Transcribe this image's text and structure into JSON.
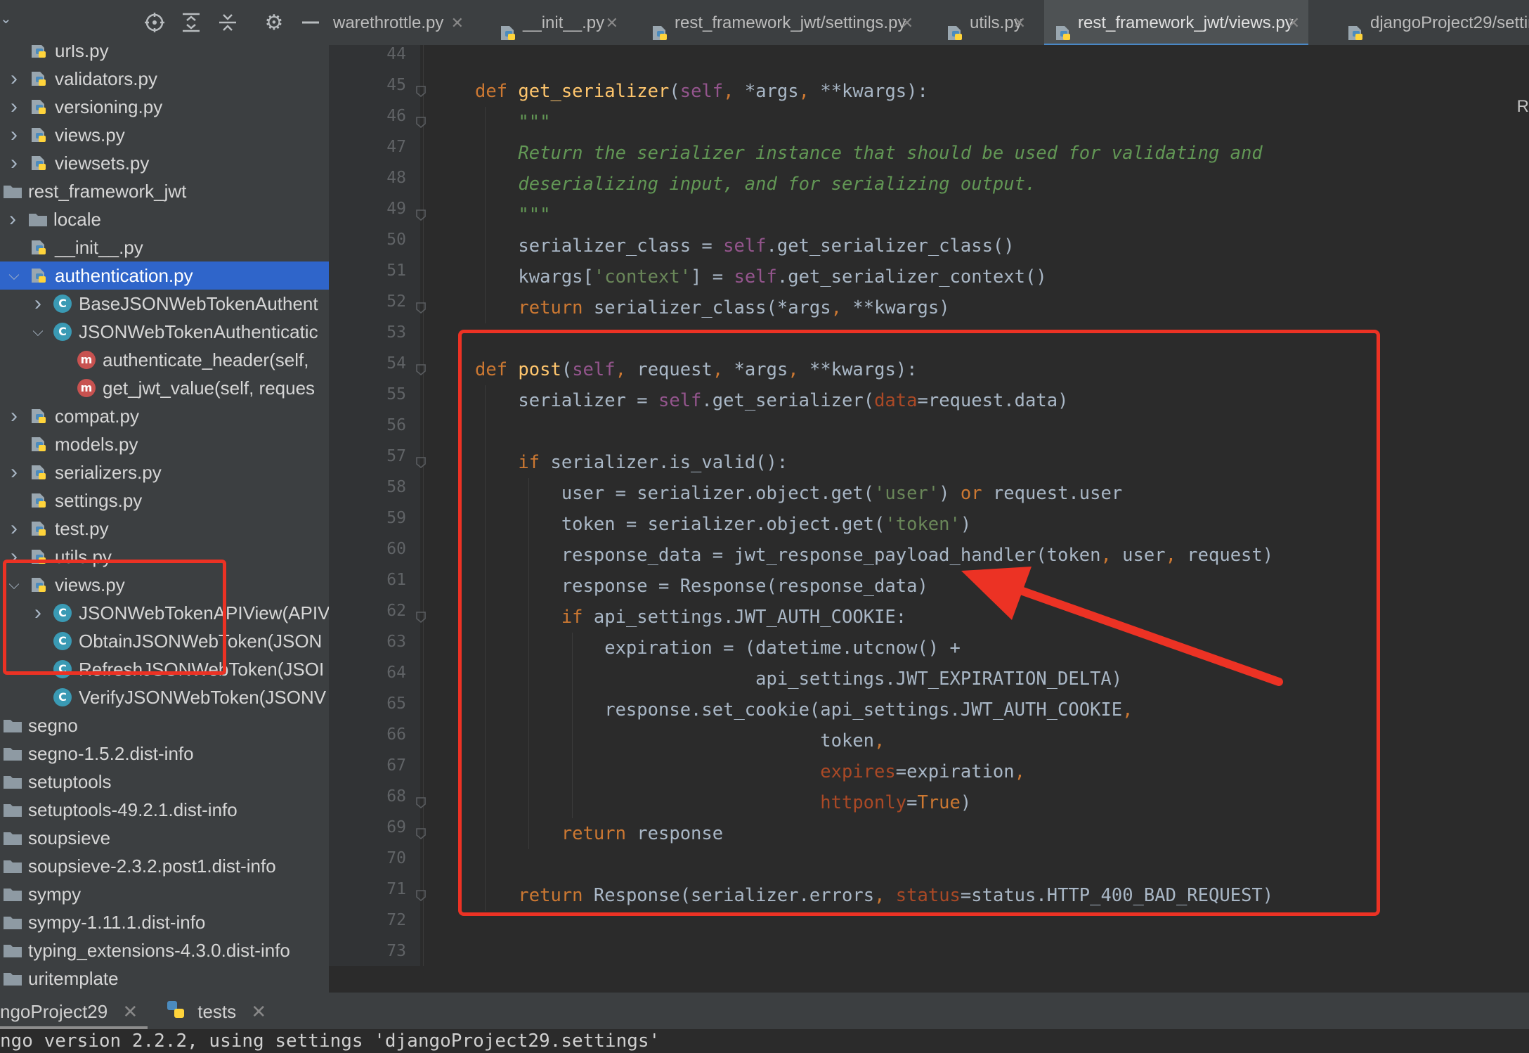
{
  "project_tree": {
    "items": [
      {
        "label": "urls.py",
        "kind": "py",
        "depth": 1,
        "arrow": ""
      },
      {
        "label": "validators.py",
        "kind": "py",
        "depth": 1,
        "arrow": ">"
      },
      {
        "label": "versioning.py",
        "kind": "py",
        "depth": 1,
        "arrow": ">"
      },
      {
        "label": "views.py",
        "kind": "py",
        "depth": 1,
        "arrow": ">"
      },
      {
        "label": "viewsets.py",
        "kind": "py",
        "depth": 1,
        "arrow": ">"
      },
      {
        "label": "rest_framework_jwt",
        "kind": "folder",
        "depth": 0,
        "arrow": ""
      },
      {
        "label": "locale",
        "kind": "folder",
        "depth": 1,
        "arrow": ">"
      },
      {
        "label": "__init__.py",
        "kind": "py",
        "depth": 1,
        "arrow": ""
      },
      {
        "label": "authentication.py",
        "kind": "py",
        "depth": 1,
        "arrow": "v",
        "selected": true
      },
      {
        "label": "BaseJSONWebTokenAuthent",
        "kind": "class",
        "depth": 2,
        "arrow": ">"
      },
      {
        "label": "JSONWebTokenAuthenticatic",
        "kind": "class",
        "depth": 2,
        "arrow": "v"
      },
      {
        "label": "authenticate_header(self,",
        "kind": "method",
        "depth": 3,
        "arrow": ""
      },
      {
        "label": "get_jwt_value(self, reques",
        "kind": "method",
        "depth": 3,
        "arrow": ""
      },
      {
        "label": "compat.py",
        "kind": "py",
        "depth": 1,
        "arrow": ">"
      },
      {
        "label": "models.py",
        "kind": "py",
        "depth": 1,
        "arrow": ""
      },
      {
        "label": "serializers.py",
        "kind": "py",
        "depth": 1,
        "arrow": ">"
      },
      {
        "label": "settings.py",
        "kind": "py",
        "depth": 1,
        "arrow": ""
      },
      {
        "label": "test.py",
        "kind": "py",
        "depth": 1,
        "arrow": ">"
      },
      {
        "label": "utils.py",
        "kind": "py",
        "depth": 1,
        "arrow": ">"
      },
      {
        "label": "views.py",
        "kind": "py",
        "depth": 1,
        "arrow": "v"
      },
      {
        "label": "JSONWebTokenAPIView(APIV",
        "kind": "class",
        "depth": 2,
        "arrow": ">"
      },
      {
        "label": "ObtainJSONWebToken(JSON",
        "kind": "class",
        "depth": 2,
        "arrow": ""
      },
      {
        "label": "RefreshJSONWebToken(JSOI",
        "kind": "class",
        "depth": 2,
        "arrow": ""
      },
      {
        "label": "VerifyJSONWebToken(JSONV",
        "kind": "class",
        "depth": 2,
        "arrow": ""
      },
      {
        "label": "segno",
        "kind": "folder",
        "depth": 0,
        "arrow": ""
      },
      {
        "label": "segno-1.5.2.dist-info",
        "kind": "folder",
        "depth": 0,
        "arrow": ""
      },
      {
        "label": "setuptools",
        "kind": "folder",
        "depth": 0,
        "arrow": ""
      },
      {
        "label": "setuptools-49.2.1.dist-info",
        "kind": "folder",
        "depth": 0,
        "arrow": ""
      },
      {
        "label": "soupsieve",
        "kind": "folder",
        "depth": 0,
        "arrow": ""
      },
      {
        "label": "soupsieve-2.3.2.post1.dist-info",
        "kind": "folder",
        "depth": 0,
        "arrow": ""
      },
      {
        "label": "sympy",
        "kind": "folder",
        "depth": 0,
        "arrow": ""
      },
      {
        "label": "sympy-1.11.1.dist-info",
        "kind": "folder",
        "depth": 0,
        "arrow": ""
      },
      {
        "label": "typing_extensions-4.3.0.dist-info",
        "kind": "folder",
        "depth": 0,
        "arrow": ""
      },
      {
        "label": "uritemplate",
        "kind": "folder",
        "depth": 0,
        "arrow": ""
      }
    ]
  },
  "tabs": [
    {
      "label": "warethrottle.py",
      "active": false,
      "icon": false
    },
    {
      "label": "__init__.py",
      "active": false,
      "icon": true
    },
    {
      "label": "rest_framework_jwt/settings.py",
      "active": false,
      "icon": true
    },
    {
      "label": "utils.py",
      "active": false,
      "icon": true
    },
    {
      "label": "rest_framework_jwt/views.py",
      "active": true,
      "icon": true
    },
    {
      "label": "djangoProject29/setting",
      "active": false,
      "icon": true,
      "no_close": true
    }
  ],
  "editor": {
    "line_numbers": [
      "44",
      "45",
      "46",
      "47",
      "48",
      "49",
      "50",
      "51",
      "52",
      "53",
      "54",
      "55",
      "56",
      "57",
      "58",
      "59",
      "60",
      "61",
      "62",
      "63",
      "64",
      "65",
      "66",
      "67",
      "68",
      "69",
      "70",
      "71",
      "72",
      "73"
    ],
    "lines": [
      [],
      [
        [
          "kw",
          "def "
        ],
        [
          "fn",
          "get_serializer"
        ],
        [
          "",
          "("
        ],
        [
          "slf",
          "self"
        ],
        [
          "kw",
          ", "
        ],
        [
          "",
          "*args"
        ],
        [
          "kw",
          ", "
        ],
        [
          "",
          "**kwargs):"
        ]
      ],
      [
        [
          "doc",
          "    \"\"\""
        ]
      ],
      [
        [
          "doc",
          "    Return the serializer instance that should be used for validating and"
        ]
      ],
      [
        [
          "doc",
          "    deserializing input, and for serializing output."
        ]
      ],
      [
        [
          "doc",
          "    \"\"\""
        ]
      ],
      [
        [
          "",
          "    serializer_class = "
        ],
        [
          "slf",
          "self"
        ],
        [
          "",
          ".get_serializer_class()"
        ]
      ],
      [
        [
          "",
          "    kwargs["
        ],
        [
          "str",
          "'context'"
        ],
        [
          "",
          "] = "
        ],
        [
          "slf",
          "self"
        ],
        [
          "",
          ".get_serializer_context()"
        ]
      ],
      [
        [
          "kw",
          "    return "
        ],
        [
          "",
          "serializer_class(*args"
        ],
        [
          "kw",
          ", "
        ],
        [
          "",
          "**kwargs)"
        ]
      ],
      [],
      [
        [
          "kw",
          "def "
        ],
        [
          "fn",
          "post"
        ],
        [
          "",
          "("
        ],
        [
          "slf",
          "self"
        ],
        [
          "kw",
          ", "
        ],
        [
          "",
          "request"
        ],
        [
          "kw",
          ", "
        ],
        [
          "",
          "*args"
        ],
        [
          "kw",
          ", "
        ],
        [
          "",
          "**kwargs):"
        ]
      ],
      [
        [
          "",
          "    serializer = "
        ],
        [
          "slf",
          "self"
        ],
        [
          "",
          ".get_serializer("
        ],
        [
          "kwarg",
          "data"
        ],
        [
          "",
          "=request.data)"
        ]
      ],
      [],
      [
        [
          "kw",
          "    if "
        ],
        [
          "",
          "serializer.is_valid():"
        ]
      ],
      [
        [
          "",
          "        user = serializer.object.get("
        ],
        [
          "str",
          "'user'"
        ],
        [
          "",
          ") "
        ],
        [
          "kw",
          "or "
        ],
        [
          "",
          "request.user"
        ]
      ],
      [
        [
          "",
          "        token = serializer.object.get("
        ],
        [
          "str",
          "'token'"
        ],
        [
          "",
          ")"
        ]
      ],
      [
        [
          "",
          "        response_data = jwt_response_payload_handler(token"
        ],
        [
          "kw",
          ", "
        ],
        [
          "",
          "user"
        ],
        [
          "kw",
          ", "
        ],
        [
          "",
          "request)"
        ]
      ],
      [
        [
          "",
          "        response = Response(response_data)"
        ]
      ],
      [
        [
          "kw",
          "        if "
        ],
        [
          "",
          "api_settings.JWT_AUTH_COOKIE:"
        ]
      ],
      [
        [
          "",
          "            expiration = (datetime.utcnow() +"
        ]
      ],
      [
        [
          "",
          "                          api_settings.JWT_EXPIRATION_DELTA)"
        ]
      ],
      [
        [
          "",
          "            response.set_cookie(api_settings.JWT_AUTH_COOKIE"
        ],
        [
          "kw",
          ","
        ]
      ],
      [
        [
          "",
          "                                token"
        ],
        [
          "kw",
          ","
        ]
      ],
      [
        [
          "kwarg",
          "                                expires"
        ],
        [
          "",
          "=expiration"
        ],
        [
          "kw",
          ","
        ]
      ],
      [
        [
          "kwarg",
          "                                httponly"
        ],
        [
          "",
          "="
        ],
        [
          "kw",
          "True"
        ],
        [
          "",
          ")"
        ]
      ],
      [
        [
          "kw",
          "        return "
        ],
        [
          "",
          "response"
        ]
      ],
      [],
      [
        [
          "kw",
          "    return "
        ],
        [
          "",
          "Response(serializer.errors"
        ],
        [
          "kw",
          ", "
        ],
        [
          "kwarg",
          "status"
        ],
        [
          "",
          "=status.HTTP_400_BAD_REQUEST)"
        ]
      ],
      [],
      []
    ]
  },
  "run_panel": {
    "tabs": [
      {
        "label": "ngoProject29"
      },
      {
        "label": "tests"
      }
    ],
    "output": "ngo version 2.2.2, using settings 'djangoProject29.settings'"
  },
  "right_edge_letter": "R",
  "colors": {
    "highlight_box": "#ec3224",
    "selection": "#2f65ca",
    "keyword": "#cc7832",
    "function": "#ffc66d",
    "self": "#94558d",
    "string": "#6a8759",
    "docstring": "#629755"
  },
  "icons": {
    "toolbar": [
      "crosshair-icon",
      "expand-all-icon",
      "collapse-all-icon",
      "gear-icon",
      "minimize-icon"
    ]
  }
}
